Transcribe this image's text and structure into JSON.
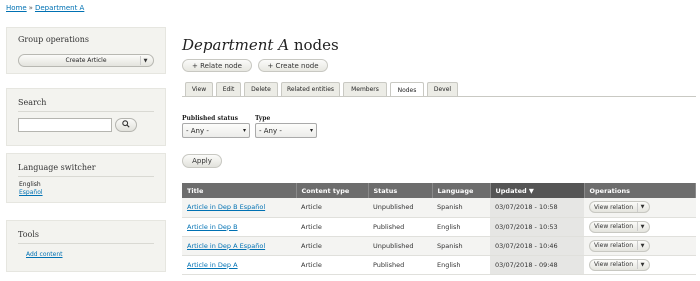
{
  "breadcrumb": {
    "home": "Home",
    "separator": "»",
    "current": "Department A"
  },
  "sidebar": {
    "group_operations": {
      "title": "Group operations",
      "select_value": "Create Article",
      "arrow": "▼"
    },
    "search": {
      "title": "Search",
      "input_value": "",
      "button_icon": "🔍"
    },
    "language_switcher": {
      "title": "Language switcher",
      "items": [
        "English",
        "Español"
      ]
    },
    "tools": {
      "title": "Tools",
      "link": "Add content"
    }
  },
  "main": {
    "title_em": "Department A",
    "title_rest": " nodes",
    "actions": [
      "+ Relate node",
      "+ Create node"
    ],
    "tabs": [
      "View",
      "Edit",
      "Delete",
      "Related entities",
      "Members",
      "Nodes",
      "Devel"
    ],
    "filters": {
      "published_status": {
        "label": "Published status",
        "value": "- Any -"
      },
      "type": {
        "label": "Type",
        "value": "- Any -"
      },
      "caret": "▾"
    },
    "apply_label": "Apply",
    "table": {
      "headers": [
        "Title",
        "Content type",
        "Status",
        "Language",
        "Updated ▼",
        "Operations"
      ],
      "rows": [
        {
          "title": "Article in Dep B Español",
          "type": "Article",
          "status": "Unpublished",
          "language": "Spanish",
          "updated": "03/07/2018 - 10:58",
          "op": "View relation"
        },
        {
          "title": "Article in Dep B",
          "type": "Article",
          "status": "Published",
          "language": "English",
          "updated": "03/07/2018 - 10:53",
          "op": "View relation"
        },
        {
          "title": "Article in Dep A Español",
          "type": "Article",
          "status": "Unpublished",
          "language": "Spanish",
          "updated": "03/07/2018 - 10:46",
          "op": "View relation"
        },
        {
          "title": "Article in Dep A",
          "type": "Article",
          "status": "Published",
          "language": "English",
          "updated": "03/07/2018 - 09:48",
          "op": "View relation"
        }
      ],
      "op_arrow": "▼"
    }
  },
  "colors": {
    "link": "#0071b3",
    "header_bg": "#6d6d6d",
    "sidebar_bg": "#f3f3ef"
  }
}
